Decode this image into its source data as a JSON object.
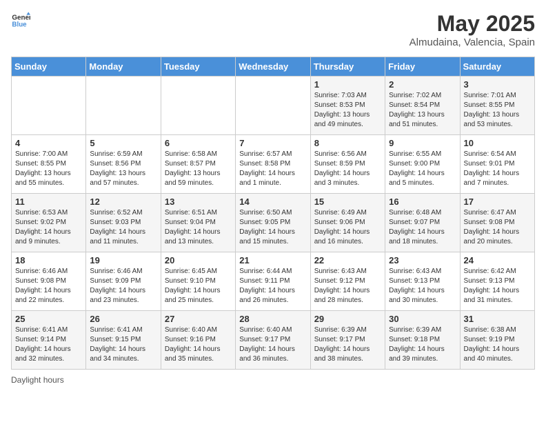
{
  "logo": {
    "line1": "General",
    "line2": "Blue"
  },
  "title": "May 2025",
  "location": "Almudaina, Valencia, Spain",
  "days_of_week": [
    "Sunday",
    "Monday",
    "Tuesday",
    "Wednesday",
    "Thursday",
    "Friday",
    "Saturday"
  ],
  "weeks": [
    [
      {
        "day": "",
        "info": ""
      },
      {
        "day": "",
        "info": ""
      },
      {
        "day": "",
        "info": ""
      },
      {
        "day": "",
        "info": ""
      },
      {
        "day": "1",
        "info": "Sunrise: 7:03 AM\nSunset: 8:53 PM\nDaylight: 13 hours\nand 49 minutes."
      },
      {
        "day": "2",
        "info": "Sunrise: 7:02 AM\nSunset: 8:54 PM\nDaylight: 13 hours\nand 51 minutes."
      },
      {
        "day": "3",
        "info": "Sunrise: 7:01 AM\nSunset: 8:55 PM\nDaylight: 13 hours\nand 53 minutes."
      }
    ],
    [
      {
        "day": "4",
        "info": "Sunrise: 7:00 AM\nSunset: 8:55 PM\nDaylight: 13 hours\nand 55 minutes."
      },
      {
        "day": "5",
        "info": "Sunrise: 6:59 AM\nSunset: 8:56 PM\nDaylight: 13 hours\nand 57 minutes."
      },
      {
        "day": "6",
        "info": "Sunrise: 6:58 AM\nSunset: 8:57 PM\nDaylight: 13 hours\nand 59 minutes."
      },
      {
        "day": "7",
        "info": "Sunrise: 6:57 AM\nSunset: 8:58 PM\nDaylight: 14 hours\nand 1 minute."
      },
      {
        "day": "8",
        "info": "Sunrise: 6:56 AM\nSunset: 8:59 PM\nDaylight: 14 hours\nand 3 minutes."
      },
      {
        "day": "9",
        "info": "Sunrise: 6:55 AM\nSunset: 9:00 PM\nDaylight: 14 hours\nand 5 minutes."
      },
      {
        "day": "10",
        "info": "Sunrise: 6:54 AM\nSunset: 9:01 PM\nDaylight: 14 hours\nand 7 minutes."
      }
    ],
    [
      {
        "day": "11",
        "info": "Sunrise: 6:53 AM\nSunset: 9:02 PM\nDaylight: 14 hours\nand 9 minutes."
      },
      {
        "day": "12",
        "info": "Sunrise: 6:52 AM\nSunset: 9:03 PM\nDaylight: 14 hours\nand 11 minutes."
      },
      {
        "day": "13",
        "info": "Sunrise: 6:51 AM\nSunset: 9:04 PM\nDaylight: 14 hours\nand 13 minutes."
      },
      {
        "day": "14",
        "info": "Sunrise: 6:50 AM\nSunset: 9:05 PM\nDaylight: 14 hours\nand 15 minutes."
      },
      {
        "day": "15",
        "info": "Sunrise: 6:49 AM\nSunset: 9:06 PM\nDaylight: 14 hours\nand 16 minutes."
      },
      {
        "day": "16",
        "info": "Sunrise: 6:48 AM\nSunset: 9:07 PM\nDaylight: 14 hours\nand 18 minutes."
      },
      {
        "day": "17",
        "info": "Sunrise: 6:47 AM\nSunset: 9:08 PM\nDaylight: 14 hours\nand 20 minutes."
      }
    ],
    [
      {
        "day": "18",
        "info": "Sunrise: 6:46 AM\nSunset: 9:08 PM\nDaylight: 14 hours\nand 22 minutes."
      },
      {
        "day": "19",
        "info": "Sunrise: 6:46 AM\nSunset: 9:09 PM\nDaylight: 14 hours\nand 23 minutes."
      },
      {
        "day": "20",
        "info": "Sunrise: 6:45 AM\nSunset: 9:10 PM\nDaylight: 14 hours\nand 25 minutes."
      },
      {
        "day": "21",
        "info": "Sunrise: 6:44 AM\nSunset: 9:11 PM\nDaylight: 14 hours\nand 26 minutes."
      },
      {
        "day": "22",
        "info": "Sunrise: 6:43 AM\nSunset: 9:12 PM\nDaylight: 14 hours\nand 28 minutes."
      },
      {
        "day": "23",
        "info": "Sunrise: 6:43 AM\nSunset: 9:13 PM\nDaylight: 14 hours\nand 30 minutes."
      },
      {
        "day": "24",
        "info": "Sunrise: 6:42 AM\nSunset: 9:13 PM\nDaylight: 14 hours\nand 31 minutes."
      }
    ],
    [
      {
        "day": "25",
        "info": "Sunrise: 6:41 AM\nSunset: 9:14 PM\nDaylight: 14 hours\nand 32 minutes."
      },
      {
        "day": "26",
        "info": "Sunrise: 6:41 AM\nSunset: 9:15 PM\nDaylight: 14 hours\nand 34 minutes."
      },
      {
        "day": "27",
        "info": "Sunrise: 6:40 AM\nSunset: 9:16 PM\nDaylight: 14 hours\nand 35 minutes."
      },
      {
        "day": "28",
        "info": "Sunrise: 6:40 AM\nSunset: 9:17 PM\nDaylight: 14 hours\nand 36 minutes."
      },
      {
        "day": "29",
        "info": "Sunrise: 6:39 AM\nSunset: 9:17 PM\nDaylight: 14 hours\nand 38 minutes."
      },
      {
        "day": "30",
        "info": "Sunrise: 6:39 AM\nSunset: 9:18 PM\nDaylight: 14 hours\nand 39 minutes."
      },
      {
        "day": "31",
        "info": "Sunrise: 6:38 AM\nSunset: 9:19 PM\nDaylight: 14 hours\nand 40 minutes."
      }
    ]
  ],
  "footer": "Daylight hours"
}
